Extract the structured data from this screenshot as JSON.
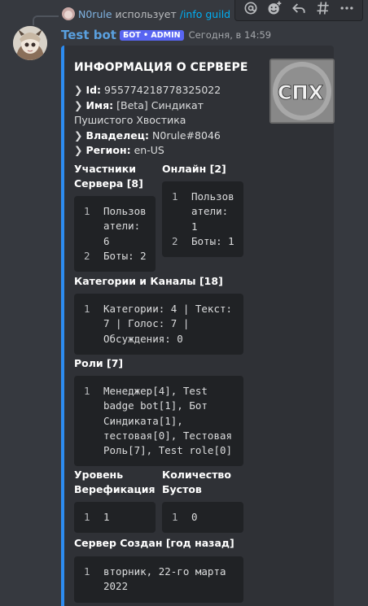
{
  "reply": {
    "username": "N0rule",
    "text": "использует",
    "command": "/info guild"
  },
  "message": {
    "username": "Test bot",
    "badge": "БОТ • ADMIN",
    "timestamp": "Сегодня, в 14:59"
  },
  "embed": {
    "accent_color": "#2d8cf0",
    "title": "ИНФОРМАЦИЯ О СЕРВЕРЕ",
    "thumbnail_text": "СПХ",
    "description": {
      "id_key": "Id:",
      "id_value": "955774218778325022",
      "name_key": "Имя:",
      "name_value": "[Beta] Синдикат Пушистого Хвостика",
      "owner_key": "Владелец:",
      "owner_value": "N0rule#8046",
      "region_key": "Регион:",
      "region_value": "en-US"
    },
    "fields": {
      "members": {
        "name": "Участники Сервера [8]",
        "lines": [
          {
            "n": "1",
            "t": "Пользов"
          },
          {
            "n": "",
            "t": "атели:"
          },
          {
            "n": "",
            "t": "6"
          },
          {
            "n": "2",
            "t": "Боты: 2"
          }
        ]
      },
      "online": {
        "name": "Онлайн [2]",
        "lines": [
          {
            "n": "1",
            "t": "Пользов"
          },
          {
            "n": "",
            "t": "атели:"
          },
          {
            "n": "",
            "t": "1"
          },
          {
            "n": "2",
            "t": "Боты: 1"
          }
        ]
      },
      "channels": {
        "name": "Категории и Каналы [18]",
        "lines": [
          {
            "n": "1",
            "t": "Категории: 4 | Текст:"
          },
          {
            "n": "",
            "t": "7 | Голос: 7 |"
          },
          {
            "n": "",
            "t": "Обсуждения: 0"
          }
        ]
      },
      "roles": {
        "name": "Роли [7]",
        "lines": [
          {
            "n": "1",
            "t": "Менеджер[4], Test"
          },
          {
            "n": "",
            "t": "badge bot[1], Бот"
          },
          {
            "n": "",
            "t": "Синдиката[1],"
          },
          {
            "n": "",
            "t": "тестовая[0], Тестовая"
          },
          {
            "n": "",
            "t": "Роль[7], Test role[0]"
          }
        ]
      },
      "verification": {
        "name": "Уровень Верефикация",
        "lines": [
          {
            "n": "1",
            "t": "1"
          }
        ]
      },
      "boosts": {
        "name": "Количество Бустов",
        "lines": [
          {
            "n": "1",
            "t": "0"
          }
        ]
      },
      "created": {
        "name": "Сервер Создан [год назад]",
        "lines": [
          {
            "n": "1",
            "t": "вторник, 22-го марта"
          },
          {
            "n": "",
            "t": "2022"
          }
        ]
      }
    }
  },
  "toolbar_icons": [
    "mention-icon",
    "add-reaction-icon",
    "reply-icon",
    "create-thread-icon",
    "more-icon"
  ]
}
